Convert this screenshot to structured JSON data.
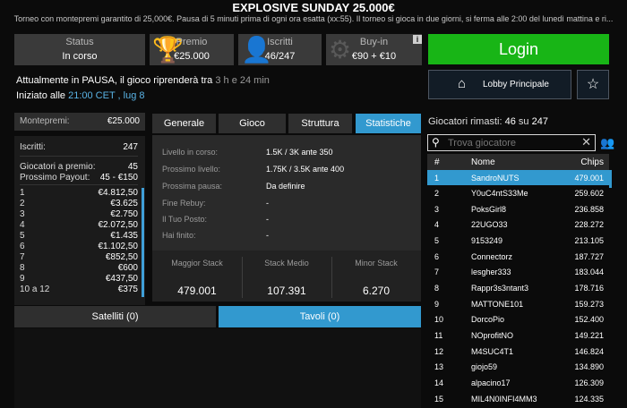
{
  "header": {
    "title": "EXPLOSIVE SUNDAY 25.000€",
    "subtitle": "Torneo con montepremi garantito di 25,000€. Pausa di 5 minuti prima di ogni ora esatta (xx:55). Il torneo si gioca in due giorni, si ferma alle 2:00 del lunedì mattina e ri..."
  },
  "status_boxes": [
    {
      "label": "Status",
      "value": "In corso",
      "icon": ""
    },
    {
      "label": "Premio",
      "value": "€25.000",
      "icon": "trophy-icon"
    },
    {
      "label": "Iscritti",
      "value": "46/247",
      "icon": "person-icon"
    },
    {
      "label": "Buy-in",
      "value": "€90 + €10",
      "icon": "chip-icon"
    }
  ],
  "info_glyph": "i",
  "pause": {
    "prefix": "Attualmente in PAUSA, il gioco riprenderà tra ",
    "time": "3 h e 24 min"
  },
  "start": {
    "prefix": "Iniziato alle ",
    "time": "21:00 CET , lug 8"
  },
  "buttons": {
    "login": "Login",
    "lobby": "Lobby Principale",
    "favorite_glyph": "☆",
    "home_glyph": "⌂"
  },
  "prize": {
    "montepremi_label": "Montepremi:",
    "montepremi_value": "€25.000",
    "iscritti_label": "Iscritti:",
    "iscritti_value": "247",
    "giocatori_label": "Giocatori a premio:",
    "giocatori_value": "45",
    "payout_label": "Prossimo Payout:",
    "payout_value": "45 - €150",
    "places": [
      {
        "pos": "1",
        "amount": "€4.812,50"
      },
      {
        "pos": "2",
        "amount": "€3.625"
      },
      {
        "pos": "3",
        "amount": "€2.750"
      },
      {
        "pos": "4",
        "amount": "€2.072,50"
      },
      {
        "pos": "5",
        "amount": "€1.435"
      },
      {
        "pos": "6",
        "amount": "€1.102,50"
      },
      {
        "pos": "7",
        "amount": "€852,50"
      },
      {
        "pos": "8",
        "amount": "€600"
      },
      {
        "pos": "9",
        "amount": "€437,50"
      },
      {
        "pos": "10 a 12",
        "amount": "€375"
      }
    ]
  },
  "tabs": [
    "Generale",
    "Gioco",
    "Struttura",
    "Statistiche"
  ],
  "stats": {
    "rows": [
      {
        "label": "Livello in corso:",
        "value": "1.5K / 3K ante 350"
      },
      {
        "label": "Prossimo livello:",
        "value": "1.75K / 3.5K ante 400"
      },
      {
        "label": "Prossima pausa:",
        "value": "Da definire"
      },
      {
        "label": "Fine Rebuy:",
        "value": "-"
      },
      {
        "label": "Il Tuo Posto:",
        "value": "-"
      },
      {
        "label": "Hai finito:",
        "value": "-"
      }
    ],
    "stacks": [
      {
        "label": "Maggior Stack",
        "value": "479.001"
      },
      {
        "label": "Stack Medio",
        "value": "107.391"
      },
      {
        "label": "Minor Stack",
        "value": "6.270"
      }
    ]
  },
  "bottom_tabs": {
    "satelliti": "Satelliti (0)",
    "tavoli": "Tavoli (0)"
  },
  "players": {
    "title_prefix": "Giocatori rimasti:",
    "remaining": "46",
    "of": "su",
    "total": "247",
    "search_placeholder": "Trova giocatore",
    "clear_glyph": "✕",
    "search_glyph": "⚲",
    "people_glyph": "👥",
    "columns": [
      "#",
      "Nome",
      "Chips"
    ],
    "rows": [
      {
        "n": "1",
        "name": "SandroNUTS",
        "chips": "479.001"
      },
      {
        "n": "2",
        "name": "Y0uC4ntS33Me",
        "chips": "259.602"
      },
      {
        "n": "3",
        "name": "PoksGirl8",
        "chips": "236.858"
      },
      {
        "n": "4",
        "name": "22UGO33",
        "chips": "228.272"
      },
      {
        "n": "5",
        "name": "9153249",
        "chips": "213.105"
      },
      {
        "n": "6",
        "name": "Connectorz",
        "chips": "187.727"
      },
      {
        "n": "7",
        "name": "lesgher333",
        "chips": "183.044"
      },
      {
        "n": "8",
        "name": "Rappr3s3ntant3",
        "chips": "178.716"
      },
      {
        "n": "9",
        "name": "MATTONE101",
        "chips": "159.273"
      },
      {
        "n": "10",
        "name": "DorcoPio",
        "chips": "152.400"
      },
      {
        "n": "11",
        "name": "NOprofitNO",
        "chips": "149.221"
      },
      {
        "n": "12",
        "name": "M4SUC4T1",
        "chips": "146.824"
      },
      {
        "n": "13",
        "name": "giojo59",
        "chips": "134.890"
      },
      {
        "n": "14",
        "name": "alpacino17",
        "chips": "126.309"
      },
      {
        "n": "15",
        "name": "MIL4N0INFI4MM3",
        "chips": "124.335"
      }
    ]
  }
}
